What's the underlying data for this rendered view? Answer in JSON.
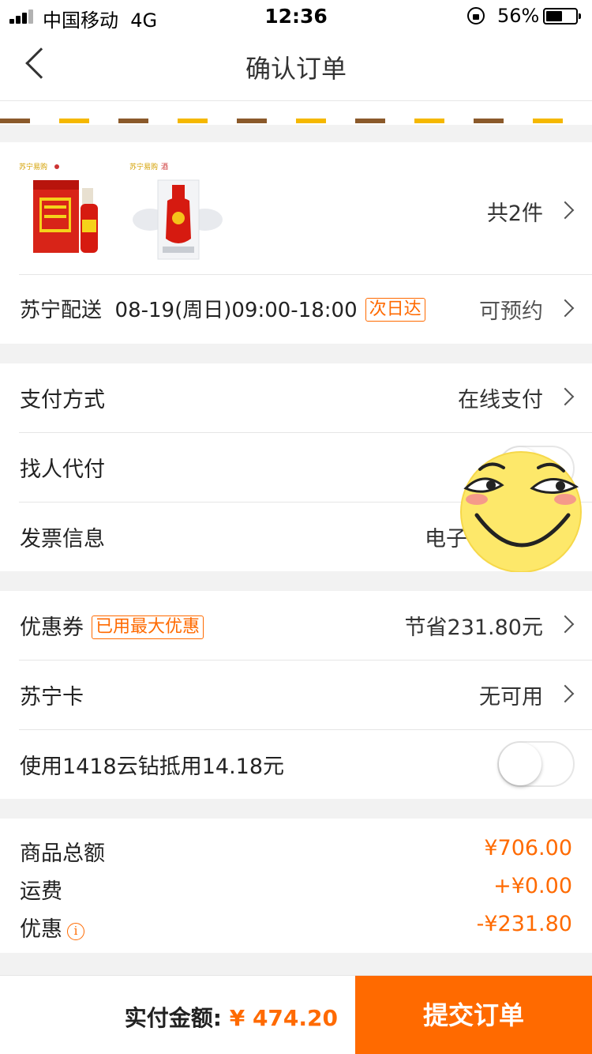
{
  "status_bar": {
    "carrier": "中国移动",
    "network": "4G",
    "time": "12:36",
    "battery": "56%",
    "battery_level": 0.56
  },
  "nav": {
    "title": "确认订单"
  },
  "products": {
    "count_label": "共2件"
  },
  "delivery": {
    "label": "苏宁配送",
    "time": "08-19(周日)09:00-18:00",
    "tag": "次日达",
    "status": "可预约"
  },
  "payment": {
    "method_label": "支付方式",
    "method_value": "在线支付",
    "proxy_label": "找人代付",
    "invoice_label": "发票信息",
    "invoice_value": "电子"
  },
  "discounts": {
    "coupon_label": "优惠券",
    "coupon_tag": "已用最大优惠",
    "coupon_value": "节省231.80元",
    "card_label": "苏宁卡",
    "card_value": "无可用",
    "diamond_label": "使用1418云钻抵用14.18元"
  },
  "totals": {
    "goods_label": "商品总额",
    "goods_value": "¥706.00",
    "shipping_label": "运费",
    "shipping_value": "+¥0.00",
    "discount_label": "优惠",
    "discount_value": "-¥231.80"
  },
  "footer": {
    "pay_label": "实付金额:",
    "pay_amount": "¥ 474.20",
    "submit": "提交订单"
  },
  "colors": {
    "accent": "#ff6a00",
    "text": "#222222",
    "background": "#f2f2f2"
  }
}
